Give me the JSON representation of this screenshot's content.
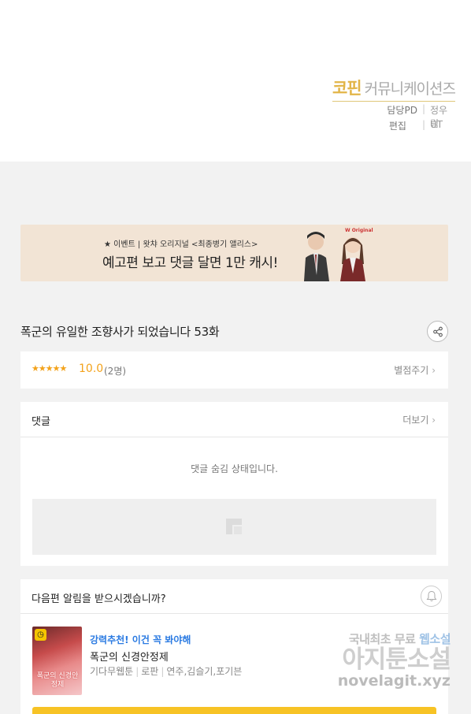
{
  "credits": {
    "publisher_brand": "코핀",
    "publisher_rest": "커뮤니케이션즈",
    "rows": [
      {
        "role": "담당PD",
        "name": "정우림"
      },
      {
        "role": "편집",
        "name": "UT"
      }
    ]
  },
  "banner": {
    "event_line": "★ 이벤트 | 왓챠 오리지널 <최종병기 앨리스>",
    "headline": "예고편 보고 댓글 달면 1만 캐시!",
    "logo_text": "W Original"
  },
  "episode": {
    "title": "폭군의 유일한 조향사가 되었습니다 53화"
  },
  "rating": {
    "stars": "★★★★★",
    "value": "10.0",
    "count": "(2명)",
    "rate_link": "별점주기"
  },
  "comments": {
    "label": "댓글",
    "more": "더보기",
    "hidden_message": "댓글 숨김 상태입니다."
  },
  "notify": {
    "question": "다음편 알림을 받으시겠습니까?",
    "recommend_tag": "강력추천! 이건 꼭 봐야해",
    "recommend_title": "폭군의 신경안정제",
    "recommend_genre": "기다무웹툰",
    "recommend_category": "로판",
    "recommend_authors": "연주,김슬기,포기븐",
    "cover_text": "폭군의 신경안정제"
  },
  "watermark": {
    "line1_a": "국내최초 무료 ",
    "line1_b": "웹소설",
    "line2": "아지툰소설",
    "line3": "novelagit.xyz"
  },
  "colors": {
    "accent_orange": "#f3a21a",
    "link_blue": "#2a7ae2",
    "button_yellow": "#f7c325",
    "brand_gold": "#e2b548"
  }
}
